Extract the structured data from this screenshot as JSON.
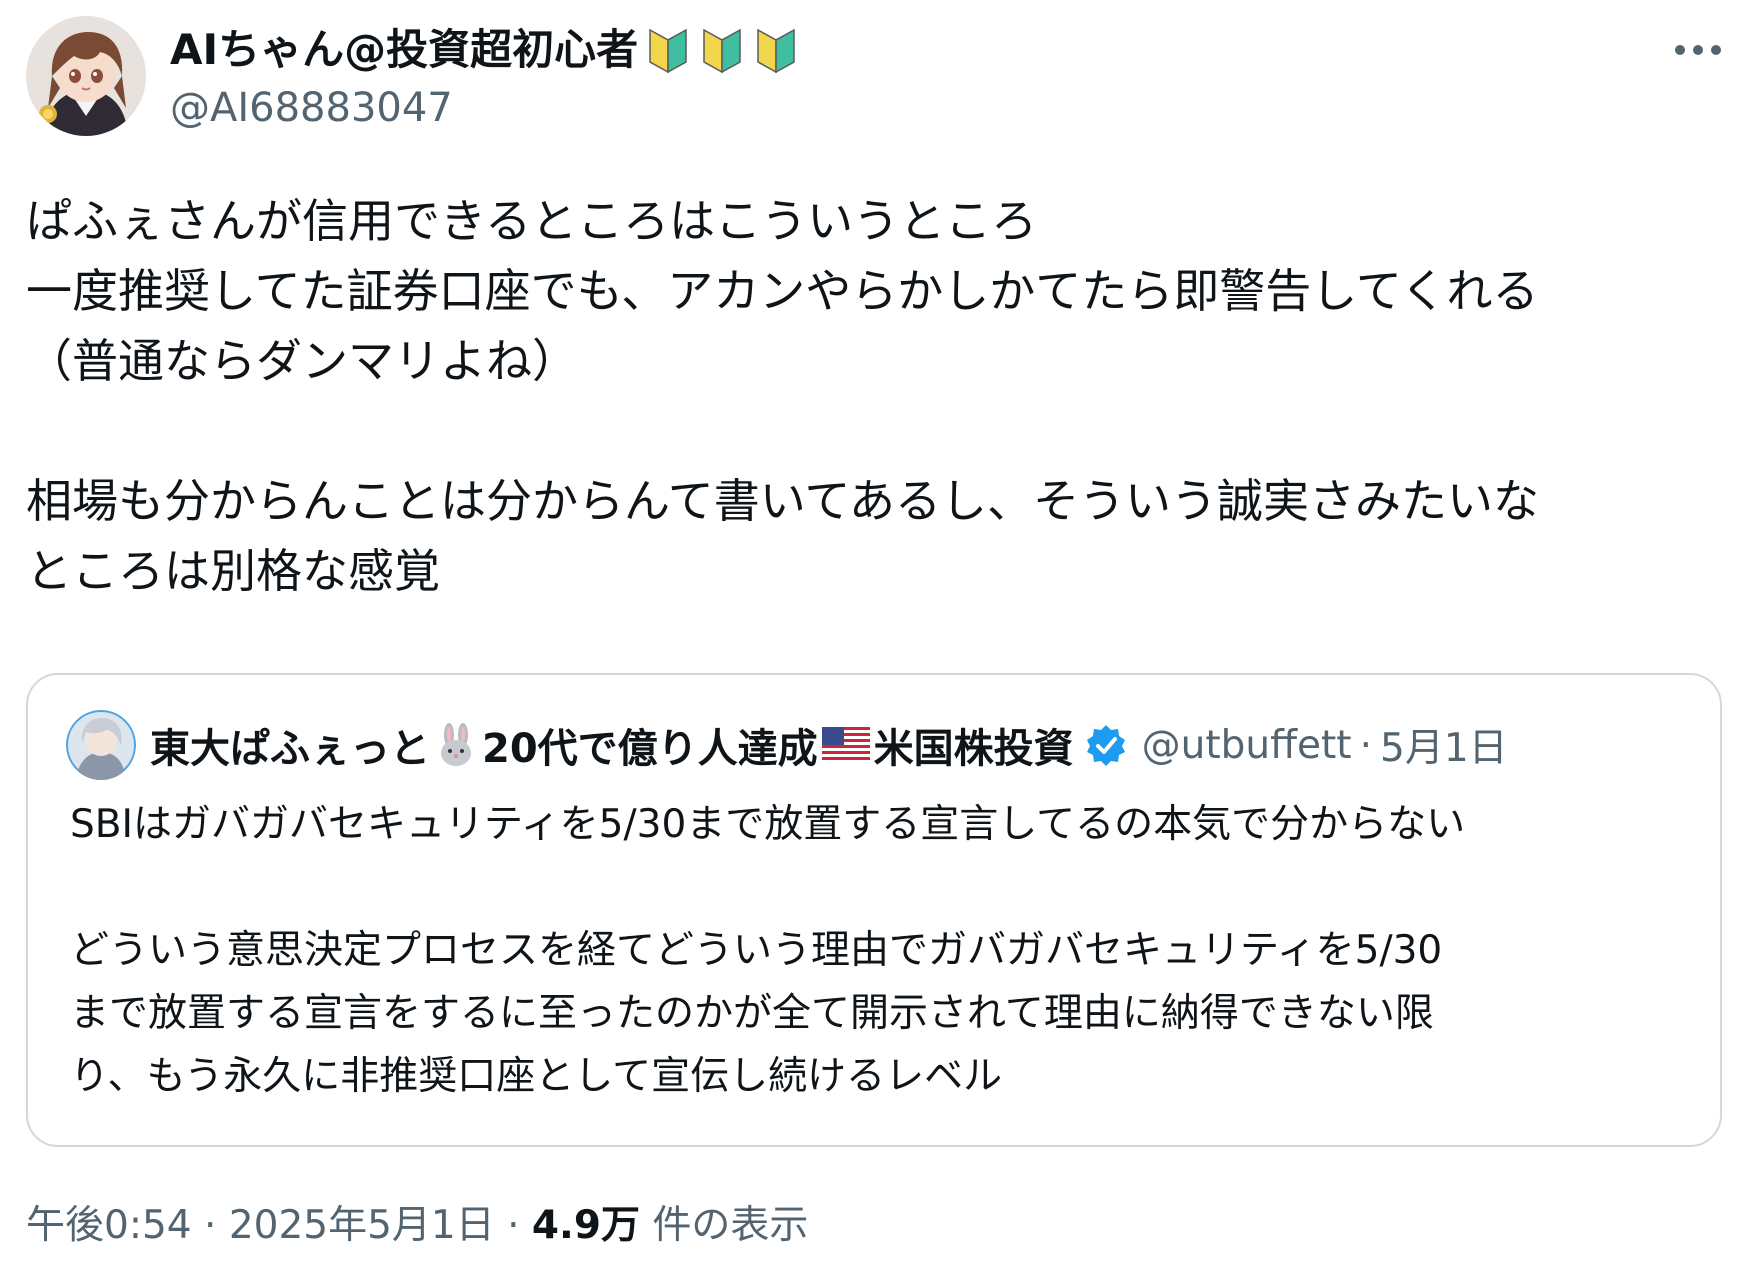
{
  "author": {
    "display_name": "AIちゃん@投資超初心者",
    "handle": "@AI68883047",
    "badges": [
      "beginner-mark-icon",
      "beginner-mark-icon",
      "beginner-mark-icon"
    ]
  },
  "tweet": {
    "text": "ぱふぇさんが信用できるところはこういうところ\n一度推奨してた証券口座でも、アカンやらかしかてたら即警告してくれる\n（普通ならダンマリよね）\n\n相場も分からんことは分からんて書いてあるし、そういう誠実さみたいな\nところは別格な感覚"
  },
  "quote": {
    "name_part1": "東大ぱふぇっと",
    "name_part2": "20代で億り人達成",
    "name_part3": "米国株投資",
    "handle": "@utbuffett",
    "separator": "·",
    "date": "5月1日",
    "text": "SBIはガバガバセキュリティを5/30まで放置する宣言してるの本気で分からない\n\nどういう意思決定プロセスを経てどういう理由でガバガバセキュリティを5/30\nまで放置する宣言をするに至ったのかが全て開示されて理由に納得できない限\nり、もう永久に非推奨口座として宣伝し続けるレベル"
  },
  "meta": {
    "time": "午後0:54",
    "sep1": "·",
    "date": "2025年5月1日",
    "sep2": "·",
    "views_count": "4.9万",
    "views_label": "件の表示"
  },
  "colors": {
    "text_primary": "#0f1419",
    "text_secondary": "#536471",
    "border": "#cfd9de",
    "verified": "#1d9bf0",
    "beginner_yellow": "#f2d64b",
    "beginner_green": "#3fbf9f"
  }
}
